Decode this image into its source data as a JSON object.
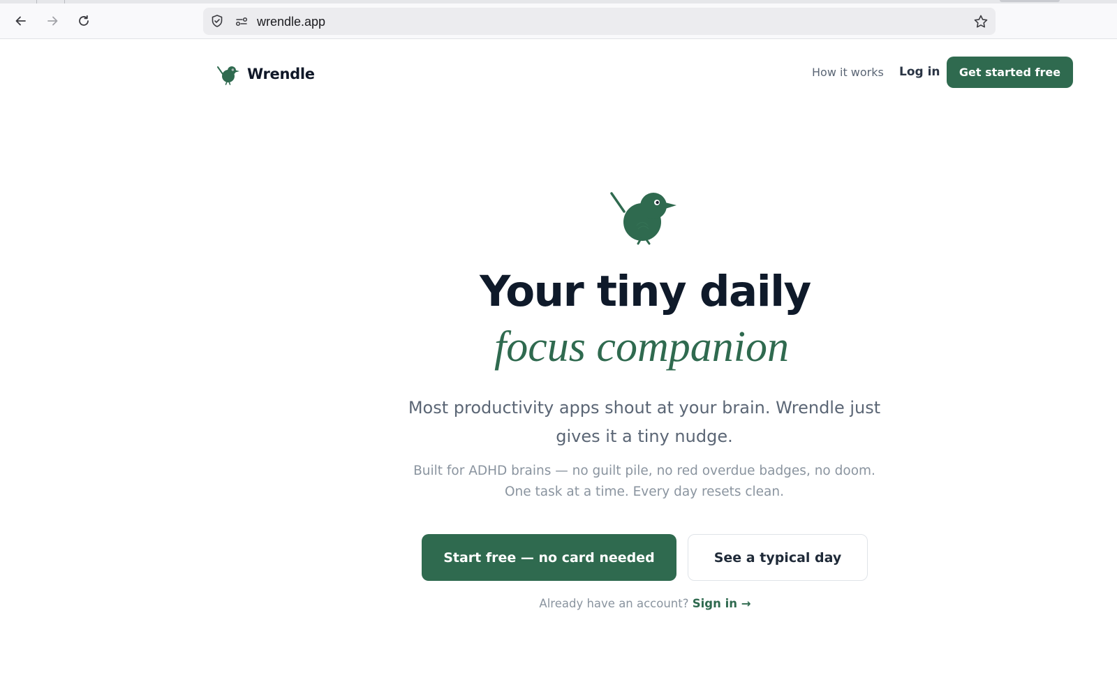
{
  "browser": {
    "url": "wrendle.app"
  },
  "header": {
    "brand_name": "Wrendle",
    "nav_how": "How it works",
    "nav_login": "Log in",
    "nav_cta": "Get started free"
  },
  "hero": {
    "title_line1": "Your tiny daily",
    "title_line2": "focus companion",
    "subtitle": "Most productivity apps shout at your brain. Wrendle just gives it a tiny nudge.",
    "note": "Built for ADHD brains — no guilt pile, no red overdue badges, no doom. One task at a time. Every day resets clean.",
    "primary_button": "Start free — no card needed",
    "secondary_button": "See a typical day",
    "account_prompt": "Already have an account?",
    "signin_link": "Sign in →"
  },
  "colors": {
    "brand_green": "#2f6a4f",
    "heading": "#0f1a2a",
    "muted_text": "#8a949f"
  },
  "icons": {
    "back": "arrow-left-icon",
    "forward": "arrow-right-icon",
    "reload": "reload-icon",
    "shield": "shield-icon",
    "permissions": "permissions-icon",
    "bookmark": "star-icon",
    "logo": "bird-logo-icon"
  }
}
